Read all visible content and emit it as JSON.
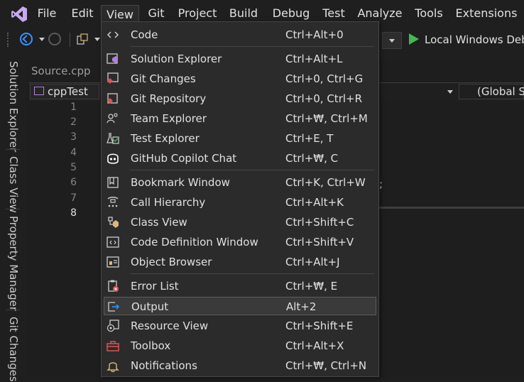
{
  "menubar": {
    "items": [
      "File",
      "Edit",
      "View",
      "Git",
      "Project",
      "Build",
      "Debug",
      "Test",
      "Analyze",
      "Tools",
      "Extensions"
    ],
    "active": "View"
  },
  "toolbar": {
    "run_target": "Local Windows Debu"
  },
  "side_tabs": [
    "Solution Explorer",
    "Class View",
    "Property Manager",
    "Git Changes"
  ],
  "editor": {
    "tab_label": "Source.cpp",
    "nav_project": "cppTest",
    "nav_scope": "(Global Sc",
    "line_numbers": [
      "1",
      "2",
      "3",
      "4",
      "5",
      "6",
      "7",
      "8"
    ],
    "code_fragment": ";"
  },
  "view_menu": {
    "items": [
      {
        "label": "Code",
        "shortcut": "Ctrl+Alt+0",
        "icon": "code-icon"
      },
      {
        "label": "Solution Explorer",
        "shortcut": "Ctrl+Alt+L",
        "icon": "solution-explorer-icon"
      },
      {
        "label": "Git Changes",
        "shortcut": "Ctrl+0, Ctrl+G",
        "icon": "git-changes-icon"
      },
      {
        "label": "Git Repository",
        "shortcut": "Ctrl+0, Ctrl+R",
        "icon": "git-repository-icon"
      },
      {
        "label": "Team Explorer",
        "shortcut": "Ctrl+₩, Ctrl+M",
        "icon": "team-explorer-icon"
      },
      {
        "label": "Test Explorer",
        "shortcut": "Ctrl+E, T",
        "icon": "test-explorer-icon"
      },
      {
        "label": "GitHub Copilot Chat",
        "shortcut": "Ctrl+₩, C",
        "icon": "copilot-icon"
      },
      {
        "label": "Bookmark Window",
        "shortcut": "Ctrl+K, Ctrl+W",
        "icon": "bookmark-icon"
      },
      {
        "label": "Call Hierarchy",
        "shortcut": "Ctrl+Alt+K",
        "icon": "call-hierarchy-icon"
      },
      {
        "label": "Class View",
        "shortcut": "Ctrl+Shift+C",
        "icon": "class-view-icon"
      },
      {
        "label": "Code Definition Window",
        "shortcut": "Ctrl+Shift+V",
        "icon": "code-definition-icon"
      },
      {
        "label": "Object Browser",
        "shortcut": "Ctrl+Alt+J",
        "icon": "object-browser-icon"
      },
      {
        "label": "Error List",
        "shortcut": "Ctrl+₩, E",
        "icon": "error-list-icon"
      },
      {
        "label": "Output",
        "shortcut": "Alt+2",
        "icon": "output-icon"
      },
      {
        "label": "Resource View",
        "shortcut": "Ctrl+Shift+E",
        "icon": "resource-view-icon"
      },
      {
        "label": "Toolbox",
        "shortcut": "Ctrl+Alt+X",
        "icon": "toolbox-icon"
      },
      {
        "label": "Notifications",
        "shortcut": "Ctrl+₩, Ctrl+N",
        "icon": "bell-icon"
      }
    ],
    "highlighted": "Output"
  },
  "colors": {
    "background": "#1f1f1f",
    "menu_background": "#2b2b2b",
    "accent_purple": "#b180d7",
    "accent_blue": "#3794ff",
    "run_green": "#3fb950",
    "error_red": "#e05252"
  }
}
